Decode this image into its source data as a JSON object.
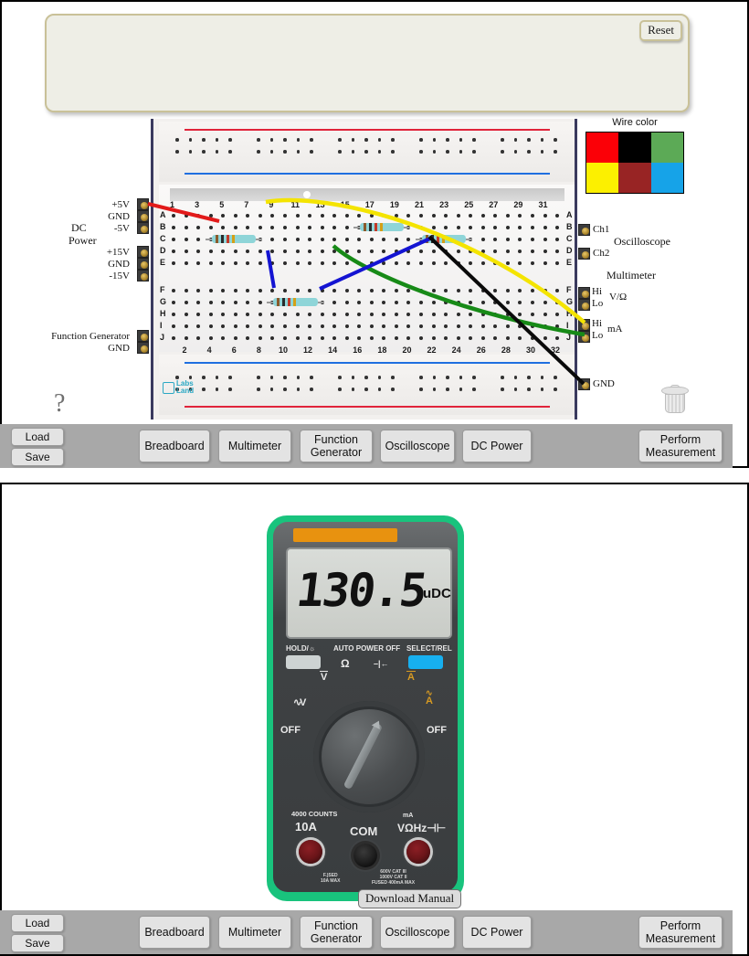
{
  "panel1": {
    "reset_label": "Reset",
    "notes_value": "",
    "help_icon": "question-mark-icon",
    "trash_icon": "trash-can-icon",
    "wire_color": {
      "title": "Wire color",
      "swatches": [
        {
          "name": "red",
          "hex": "#fb0007"
        },
        {
          "name": "black",
          "hex": "#000000"
        },
        {
          "name": "green",
          "hex": "#5caa56"
        },
        {
          "name": "yellow",
          "hex": "#fcf000"
        },
        {
          "name": "darkred",
          "hex": "#982424"
        },
        {
          "name": "blue",
          "hex": "#16a3e8"
        }
      ]
    },
    "left_jacks": {
      "dc_power_group": "DC\nPower",
      "dc_power_label_line1": "DC",
      "dc_power_label_line2": "Power",
      "items": [
        "+5V",
        "GND",
        "-5V",
        "+15V",
        "GND",
        "-15V"
      ],
      "function_generator_label": "Function Generator",
      "function_generator_gnd": "GND"
    },
    "right_jacks": {
      "oscilloscope_label": "Oscilloscope",
      "ch1": "Ch1",
      "ch2": "Ch2",
      "multimeter_label": "Multimeter",
      "v_ohm_label": "V/Ω",
      "v_ohm_hi": "Hi",
      "v_ohm_lo": "Lo",
      "ma_label": "mA",
      "ma_hi": "Hi",
      "ma_lo": "Lo",
      "gnd": "GND"
    },
    "breadboard": {
      "row_labels_top": [
        "A",
        "B",
        "C",
        "D",
        "E"
      ],
      "row_labels_bottom": [
        "F",
        "G",
        "H",
        "I",
        "J"
      ],
      "col_numbers_top": [
        "1",
        "3",
        "5",
        "7",
        "9",
        "11",
        "13",
        "15",
        "17",
        "19",
        "21",
        "23",
        "25",
        "27",
        "29",
        "31"
      ],
      "col_numbers_bottom": [
        "2",
        "4",
        "6",
        "8",
        "10",
        "12",
        "14",
        "16",
        "18",
        "20",
        "22",
        "24",
        "26",
        "28",
        "30",
        "32"
      ],
      "logo_text_1": "Labs",
      "logo_text_2": "Land",
      "components": [
        {
          "type": "resistor",
          "row": "C",
          "from_col": 4,
          "to_col": 8
        },
        {
          "type": "resistor",
          "row": "B",
          "from_col": 16,
          "to_col": 20
        },
        {
          "type": "resistor",
          "row": "C",
          "from_col": 21,
          "to_col": 25
        },
        {
          "type": "resistor",
          "row": "G",
          "from_col": 9,
          "to_col": 13
        }
      ],
      "wires": [
        {
          "color": "#e21a1a",
          "name": "wire-red-5v-to-b3"
        },
        {
          "color": "#f4e400",
          "name": "wire-yellow-a8-to-multimeter-ma-hi"
        },
        {
          "color": "#1a8a1a",
          "name": "wire-green-c17-to-multimeter-ma-lo"
        },
        {
          "color": "#1414d2",
          "name": "wire-blue-e9-to-f11"
        },
        {
          "color": "#1414d2",
          "name": "wire-blue-f14-to-e22"
        },
        {
          "color": "#000000",
          "name": "wire-black-c23-to-gnd"
        }
      ]
    }
  },
  "toolbar": {
    "load_label": "Load",
    "save_label": "Save",
    "breadboard_label": "Breadboard",
    "multimeter_label": "Multimeter",
    "function_generator_label": "Function\nGenerator",
    "function_generator_line1": "Function",
    "function_generator_line2": "Generator",
    "oscilloscope_label": "Oscilloscope",
    "dc_power_label": "DC Power",
    "perform_measurement_line1": "Perform",
    "perform_measurement_line2": "Measurement"
  },
  "panel2": {
    "multimeter": {
      "display_value": "130.5",
      "display_unit": "uDC",
      "hold_label": "HOLD/☼",
      "auto_power_off_label": "AUTO POWER OFF",
      "select_rel_label": "SELECT/REL",
      "ohm_symbol": "Ω",
      "diode_symbol": "–|←",
      "dial_marks": [
        {
          "label": "V",
          "name": "dial-dc-voltage",
          "overline": true
        },
        {
          "label": "V",
          "name": "dial-ac-voltage",
          "tilde": true
        },
        {
          "label": "OFF",
          "name": "dial-off-left"
        },
        {
          "label": "A",
          "name": "dial-dc-current",
          "overline": true
        },
        {
          "label": "A",
          "name": "dial-ac-current",
          "tilde": true
        },
        {
          "label": "OFF",
          "name": "dial-off-right"
        }
      ],
      "counts_label": "4000 COUNTS",
      "jack_10a": "10A",
      "jack_com": "COM",
      "jack_vohm": "VΩHz",
      "jack_vohm_top": "mA",
      "fuse_note": "F.)SED\n10A MAX",
      "cat_note": "600V CAT III\n1000V CAT II\nFUSED 400mA MAX",
      "download_manual_label": "Download Manual"
    }
  }
}
